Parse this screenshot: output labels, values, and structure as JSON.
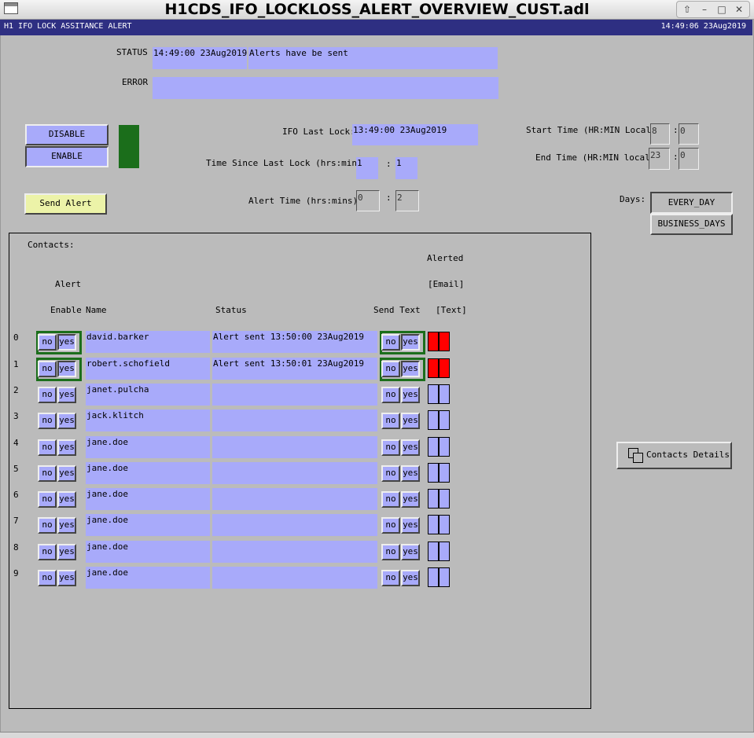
{
  "window": {
    "title": "H1CDS_IFO_LOCKLOSS_ALERT_OVERVIEW_CUST.adl",
    "buttons": [
      "⇧",
      "–",
      "□",
      "✕"
    ]
  },
  "header": {
    "title": "H1 IFO LOCK ASSITANCE ALERT",
    "time": "14:49:06 23Aug2019"
  },
  "status": {
    "label": "STATUS",
    "time": "14:49:00 23Aug2019",
    "message": "Alerts have be sent"
  },
  "error": {
    "label": "ERROR",
    "message": ""
  },
  "controls": {
    "disable_label": "DISABLE",
    "enable_label": "ENABLE",
    "send_alert_label": "Send Alert",
    "enabled_color": "#1b6e1b"
  },
  "lock": {
    "last_lock_label": "IFO Last Lock:",
    "last_lock_value": "13:49:00 23Aug2019",
    "since_label": "Time Since Last Lock (hrs:mins)",
    "since_hrs": "1",
    "since_mins": "1",
    "alert_time_label": "Alert Time (hrs:mins)",
    "alert_hrs": "0",
    "alert_mins": "2",
    "colon": ":"
  },
  "schedule": {
    "start_label": "Start Time (HR:MIN Local)",
    "start_hr": "8",
    "start_min": "0",
    "end_label": "End Time (HR:MIN local)",
    "end_hr": "23",
    "end_min": "0",
    "days_label": "Days:",
    "every_day": "EVERY_DAY",
    "business_days": "BUSINESS_DAYS"
  },
  "contacts": {
    "title": "Contacts:",
    "col_alerted": "Alerted",
    "col_alert": "Alert",
    "col_email": "[Email]",
    "col_enable": "Enable",
    "col_name": "Name",
    "col_status": "Status",
    "col_send_text": "Send Text",
    "col_text": "[Text]",
    "no_label": "no",
    "yes_label": "yes",
    "details_button": "Contacts Details",
    "rows": [
      {
        "idx": "0",
        "name": "david.barker",
        "status": "Alert sent 13:50:00 23Aug2019",
        "enable": true,
        "send_text": true,
        "email_alerted": true,
        "text_alerted": true
      },
      {
        "idx": "1",
        "name": "robert.schofield",
        "status": "Alert sent 13:50:01 23Aug2019",
        "enable": true,
        "send_text": true,
        "email_alerted": true,
        "text_alerted": true
      },
      {
        "idx": "2",
        "name": "janet.pulcha",
        "status": "",
        "enable": false,
        "send_text": false,
        "email_alerted": false,
        "text_alerted": false
      },
      {
        "idx": "3",
        "name": "jack.klitch",
        "status": "",
        "enable": false,
        "send_text": false,
        "email_alerted": false,
        "text_alerted": false
      },
      {
        "idx": "4",
        "name": "jane.doe",
        "status": "",
        "enable": false,
        "send_text": false,
        "email_alerted": false,
        "text_alerted": false
      },
      {
        "idx": "5",
        "name": "jane.doe",
        "status": "",
        "enable": false,
        "send_text": false,
        "email_alerted": false,
        "text_alerted": false
      },
      {
        "idx": "6",
        "name": "jane.doe",
        "status": "",
        "enable": false,
        "send_text": false,
        "email_alerted": false,
        "text_alerted": false
      },
      {
        "idx": "7",
        "name": "jane.doe",
        "status": "",
        "enable": false,
        "send_text": false,
        "email_alerted": false,
        "text_alerted": false
      },
      {
        "idx": "8",
        "name": "jane.doe",
        "status": "",
        "enable": false,
        "send_text": false,
        "email_alerted": false,
        "text_alerted": false
      },
      {
        "idx": "9",
        "name": "jane.doe",
        "status": "",
        "enable": false,
        "send_text": false,
        "email_alerted": false,
        "text_alerted": false
      }
    ]
  }
}
